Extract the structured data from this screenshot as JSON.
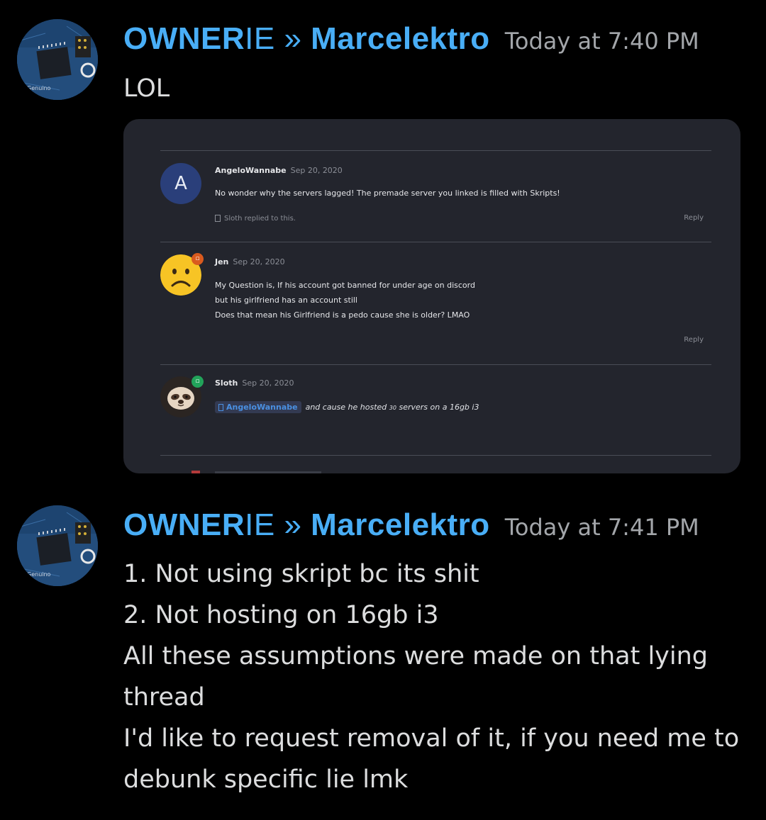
{
  "messages": [
    {
      "author_prefix": "OWNER",
      "author_thin": "IE",
      "author_sep": " » ",
      "author_name": "Marcelektro",
      "timestamp": "Today at 7:40 PM",
      "text": "LOL"
    },
    {
      "author_prefix": "OWNER",
      "author_thin": "IE",
      "author_sep": " » ",
      "author_name": "Marcelektro",
      "timestamp": "Today at 7:41 PM",
      "lines": [
        "1. Not using skript bc its shit",
        "2. Not hosting on 16gb i3",
        "All these assumptions were made on that lying",
        "thread",
        "I'd like to request removal of it, if you need me to",
        "debunk specific lie lmk"
      ]
    }
  ],
  "embed": {
    "posts": [
      {
        "avatar_letter": "A",
        "author": "AngeloWannabe",
        "date": "Sep 20, 2020",
        "body": "No wonder why the servers lagged! The premade server you linked is filled with Skripts!",
        "footer": "Sloth replied to this.",
        "reply": "Reply"
      },
      {
        "author": "Jen",
        "date": "Sep 20, 2020",
        "body_lines": [
          "My Question is, If his account got banned for under age on discord",
          "but his girlfriend has an account still",
          "Does that mean his Girlfriend is a pedo cause she is older? LMAO"
        ],
        "reply": "Reply"
      },
      {
        "author": "Sloth",
        "date": "Sep 20, 2020",
        "mention": "AngeloWannabe",
        "quote_pre": "and cause he hosted ",
        "quote_small": "30",
        "quote_post": " servers on a 16gb i3"
      }
    ]
  },
  "colors": {
    "background": "#000000",
    "username": "#49aef6",
    "timestamp": "#a3a6aa",
    "embed_bg": "#23252d",
    "mention": "#4a90e2"
  }
}
